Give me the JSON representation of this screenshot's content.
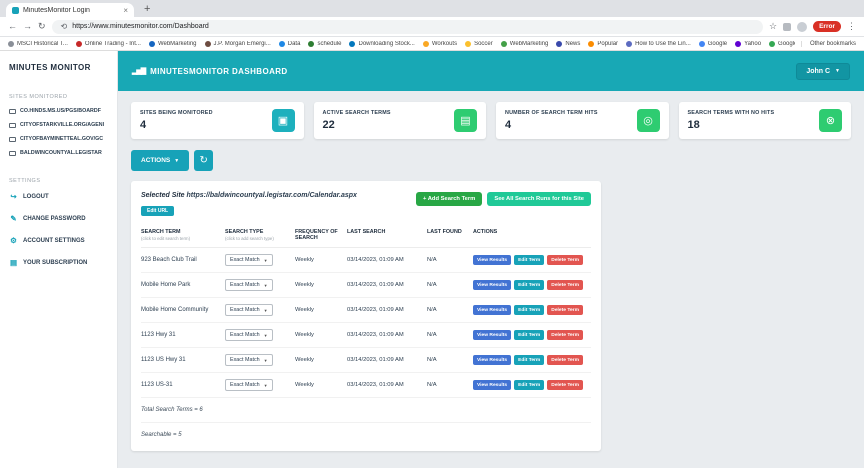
{
  "icons": {
    "back": "←",
    "forward": "→",
    "reload": "↻",
    "close": "×",
    "new_tab": "+",
    "star": "☆",
    "menu": "⋮",
    "chart": "▂▅▇",
    "caret": "▼",
    "refresh": "↻"
  },
  "browser": {
    "tab_title": "MinutesMonitor Login",
    "url": "https://www.minutesmonitor.com/Dashboard",
    "profile_label": "Error",
    "other_bookmarks": "Other bookmarks",
    "bookmarks": [
      {
        "label": "MSCI Historical T...",
        "color": "#8a8f98"
      },
      {
        "label": "Online Trading - Int...",
        "color": "#c62828"
      },
      {
        "label": "WebMarketing",
        "color": "#1565c0"
      },
      {
        "label": "J.P. Morgan Emergi...",
        "color": "#6d4c41"
      },
      {
        "label": "Data",
        "color": "#1e88e5"
      },
      {
        "label": "schedule",
        "color": "#2e7d32"
      },
      {
        "label": "Downloading Stock...",
        "color": "#0277bd"
      },
      {
        "label": "Workouts",
        "color": "#f9a825"
      },
      {
        "label": "Soccer",
        "color": "#fbc02d"
      },
      {
        "label": "WebMarketing",
        "color": "#43a047"
      },
      {
        "label": "News",
        "color": "#3949ab"
      },
      {
        "label": "Popular",
        "color": "#fb8c00"
      },
      {
        "label": "How to Use the Lin...",
        "color": "#5c6bc0"
      },
      {
        "label": "Google",
        "color": "#4285f4"
      },
      {
        "label": "Yahoo",
        "color": "#6001d2"
      },
      {
        "label": "Google",
        "color": "#34a853"
      }
    ]
  },
  "sidebar": {
    "brand": "MINUTES MONITOR",
    "sites_heading": "SITES MONITORED",
    "sites": [
      {
        "label": "CO.HINDS.MS.US/PGS/BOARDF"
      },
      {
        "label": "CITYOFSTARKVILLE.ORG/AGENI"
      },
      {
        "label": "CITYOFBAYMINETTEAL.GOV/GC"
      },
      {
        "label": "BALDWINCOUNTYAL.LEGISTAR"
      }
    ],
    "settings_heading": "SETTINGS",
    "settings": [
      {
        "label": "LOGOUT",
        "icon": "↪"
      },
      {
        "label": "CHANGE PASSWORD",
        "icon": "✎"
      },
      {
        "label": "ACCOUNT SETTINGS",
        "icon": "⚙"
      },
      {
        "label": "YOUR SUBSCRIPTION",
        "icon": "▤"
      }
    ]
  },
  "header": {
    "title": "MINUTESMONITOR DASHBOARD",
    "user_label": "John C"
  },
  "cards": [
    {
      "label": "SITES BEING MONITORED",
      "value": "4",
      "color": "#1db0bd",
      "icon": "▣"
    },
    {
      "label": "ACTIVE SEARCH TERMS",
      "value": "22",
      "color": "#2ecc71",
      "icon": "▤"
    },
    {
      "label": "NUMBER OF SEARCH TERM HITS",
      "value": "4",
      "color": "#2ecc71",
      "icon": "◎"
    },
    {
      "label": "SEARCH TERMS WITH NO HITS",
      "value": "18",
      "color": "#2ecc71",
      "icon": "⊗"
    }
  ],
  "toolbar": {
    "actions_label": "ACTIONS"
  },
  "panel": {
    "selected_site_label": "Selected Site",
    "selected_site_url": "https://baldwincountyal.legistar.com/Calendar.aspx",
    "edit_url_label": "Edit URL",
    "add_term_label": "+ Add Search Term",
    "see_all_label": "See All Search Runs for this Site",
    "table": {
      "headers": [
        {
          "label": "SEARCH TERM",
          "sub": "(click to edit search term)"
        },
        {
          "label": "SEARCH TYPE",
          "sub": "(click to add search type)"
        },
        {
          "label": "FREQUENCY OF SEARCH",
          "sub": ""
        },
        {
          "label": "LAST SEARCH",
          "sub": ""
        },
        {
          "label": "LAST FOUND",
          "sub": ""
        },
        {
          "label": "ACTIONS",
          "sub": ""
        }
      ],
      "actions": {
        "view": "View Results",
        "edit": "Edit Term",
        "delete": "Delete Term"
      },
      "rows": [
        {
          "term": "923 Beach Club Trail",
          "type": "Exact Match",
          "frequency": "Weekly",
          "last_search": "03/14/2023, 01:09 AM",
          "last_found": "N/A"
        },
        {
          "term": "Mobile Home Park",
          "type": "Exact Match",
          "frequency": "Weekly",
          "last_search": "03/14/2023, 01:09 AM",
          "last_found": "N/A"
        },
        {
          "term": "Mobile Home Community",
          "type": "Exact Match",
          "frequency": "Weekly",
          "last_search": "03/14/2023, 01:09 AM",
          "last_found": "N/A"
        },
        {
          "term": "1123 Hwy 31",
          "type": "Exact Match",
          "frequency": "Weekly",
          "last_search": "03/14/2023, 01:09 AM",
          "last_found": "N/A"
        },
        {
          "term": "1123 US Hwy 31",
          "type": "Exact Match",
          "frequency": "Weekly",
          "last_search": "03/14/2023, 01:09 AM",
          "last_found": "N/A"
        },
        {
          "term": "1123 US-31",
          "type": "Exact Match",
          "frequency": "Weekly",
          "last_search": "03/14/2023, 01:09 AM",
          "last_found": "N/A"
        }
      ],
      "total_text": "Total Search Terms = 6",
      "searchable_text": "Searchable = 5"
    }
  }
}
